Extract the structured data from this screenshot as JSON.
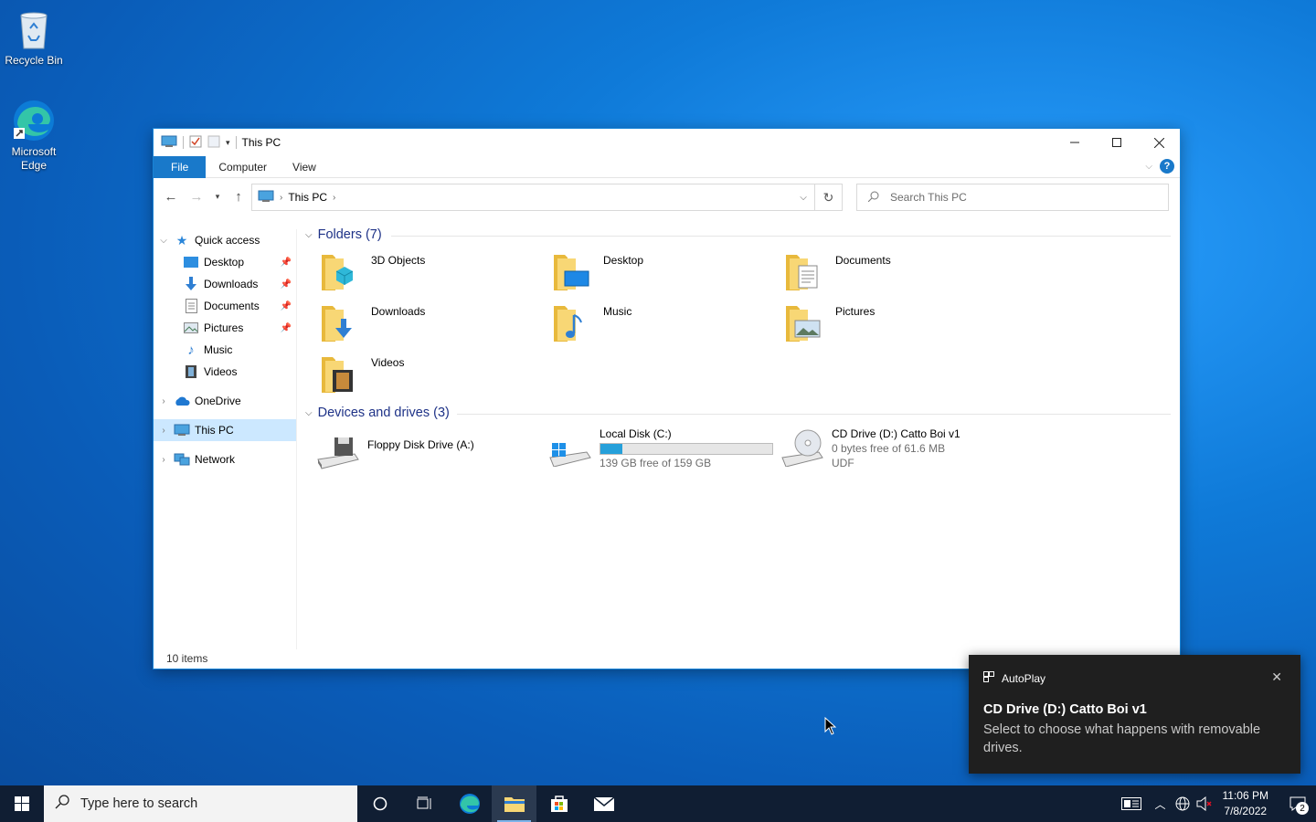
{
  "desktop": {
    "icons": [
      {
        "label": "Recycle Bin"
      },
      {
        "label": "Microsoft Edge"
      }
    ]
  },
  "window": {
    "title": "This PC",
    "ribbon_tabs": [
      "File",
      "Computer",
      "View"
    ],
    "address": {
      "crumb": "This PC"
    },
    "search_placeholder": "Search This PC",
    "sidebar": {
      "quick_access": "Quick access",
      "quick_items": [
        "Desktop",
        "Downloads",
        "Documents",
        "Pictures",
        "Music",
        "Videos"
      ],
      "onedrive": "OneDrive",
      "this_pc": "This PC",
      "network": "Network"
    },
    "folders_header": "Folders (7)",
    "folders": [
      "3D Objects",
      "Desktop",
      "Documents",
      "Downloads",
      "Music",
      "Pictures",
      "Videos"
    ],
    "drives_header": "Devices and drives (3)",
    "drives": [
      {
        "name": "Floppy Disk Drive (A:)"
      },
      {
        "name": "Local Disk (C:)",
        "free_text": "139 GB free of 159 GB",
        "used_fraction": 0.13
      },
      {
        "name": "CD Drive (D:) Catto Boi v1",
        "free_text": "0 bytes free of 61.6 MB",
        "fs": "UDF"
      }
    ],
    "status": "10 items"
  },
  "toast": {
    "app": "AutoPlay",
    "title": "CD Drive (D:) Catto Boi v1",
    "body": "Select to choose what happens with removable drives."
  },
  "taskbar": {
    "search_placeholder": "Type here to search",
    "time": "11:06 PM",
    "date": "7/8/2022",
    "notification_count": "2"
  },
  "colors": {
    "accent": "#1979ca",
    "folder": "#f8d775",
    "selection": "#cce8ff",
    "taskbar": "#101e33"
  }
}
